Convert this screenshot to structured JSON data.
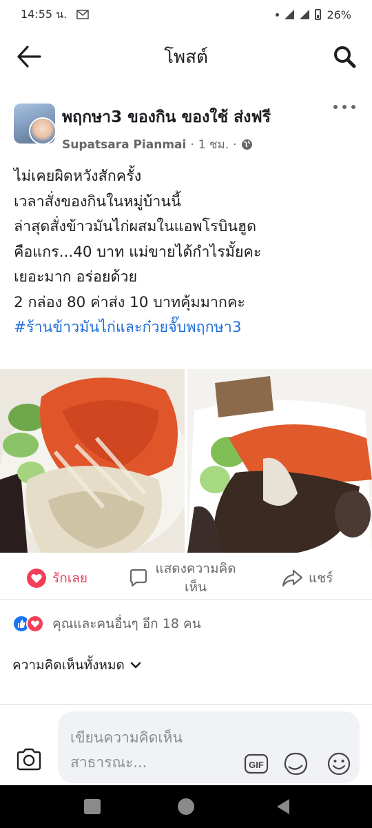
{
  "status": {
    "time": "14:55 น.",
    "battery": "26%",
    "icons": [
      "gmail-icon",
      "dot-icon",
      "signal-icon",
      "signal-icon",
      "battery-icon"
    ]
  },
  "header": {
    "title": "โพสต์",
    "back_icon": "arrow-left-icon",
    "search_icon": "search-icon"
  },
  "post": {
    "group_name": "พฤกษา3 ของกิน ของใช้ ส่งฟรี",
    "author": "Supatsara Pianmai",
    "separator": "·",
    "time": "1 ชม.",
    "privacy_separator": "·",
    "text_lines": [
      "ไม่เคยผิดหวังสักครั้ง",
      "เวลาสั่งของกินในหมู่บ้านนี้",
      "ล่าสุดสั่งข้าวมันไก่ผสมในแอพโรบินฮูด",
      "คือแกร...40 บาท  แม่ขายได้กำไรมั้ยคะ",
      "เยอะมาก อร่อยด้วย",
      "2 กล่อง 80 ค่าส่ง 10 บาทคุ้มมากคะ"
    ],
    "hashtag": "#ร้านข้าวมันไก่และก๋วยจั๊บพฤกษา3"
  },
  "actions": {
    "like": "รักเลย",
    "comment": "แสดงความคิดเห็น",
    "share": "แชร์"
  },
  "reactions": {
    "text": "คุณและคนอื่นๆ อีก 18 คน"
  },
  "comments": {
    "filter_label": "ความคิดเห็นทั้งหมด"
  },
  "composer": {
    "placeholder": "เขียนความคิดเห็นสาธารณะ...",
    "gif_label": "GIF"
  },
  "colors": {
    "accent": "#1877f2",
    "love": "#e4405f",
    "hashtag": "#216fdb",
    "muted": "#65676b"
  }
}
